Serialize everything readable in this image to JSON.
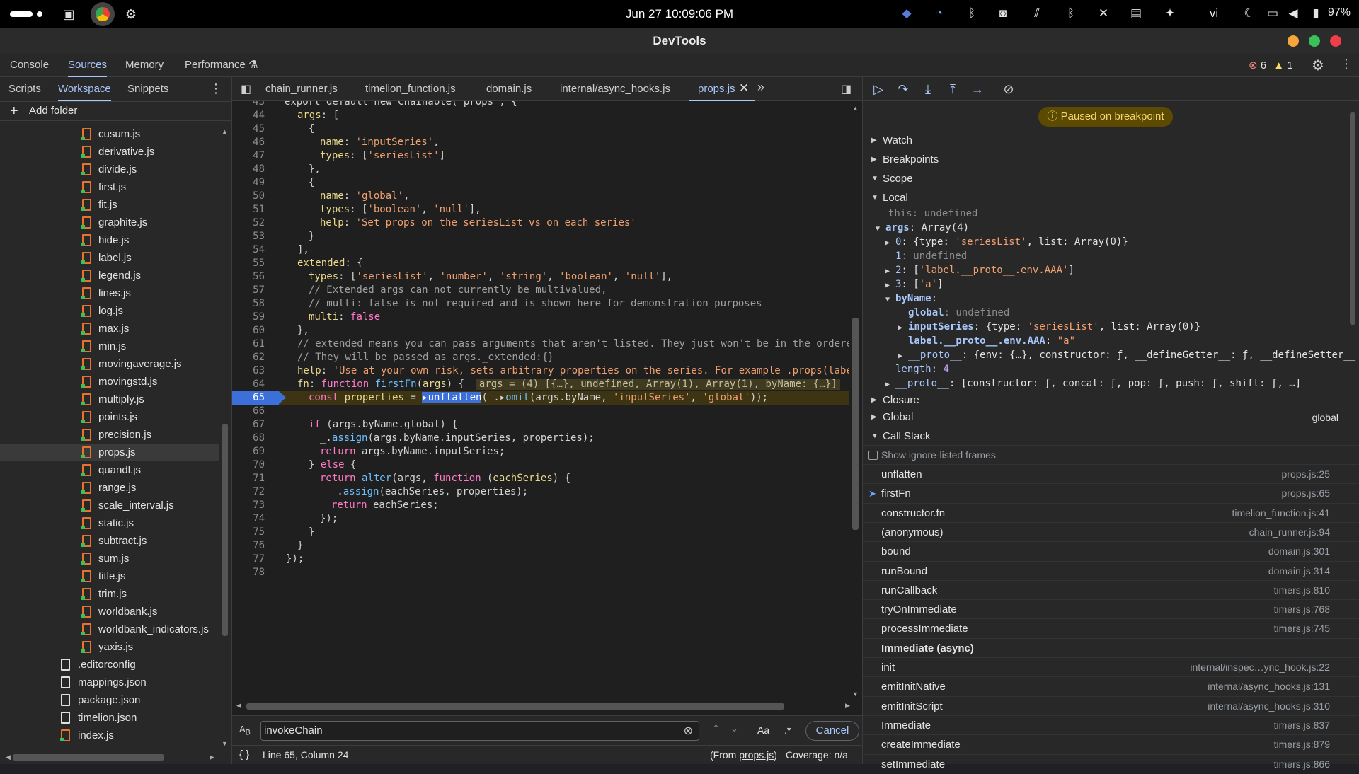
{
  "system": {
    "clock": "Jun 27  10:09:06 PM",
    "battery": "97%",
    "keyboard": "vi"
  },
  "window": {
    "title": "DevTools"
  },
  "main_tabs": [
    "Console",
    "Sources",
    "Memory",
    "Performance"
  ],
  "counts": {
    "errors": "6",
    "warnings": "1"
  },
  "left": {
    "tabs": [
      "Scripts",
      "Workspace",
      "Snippets"
    ],
    "add_folder": "Add folder",
    "files": [
      "cusum.js",
      "derivative.js",
      "divide.js",
      "first.js",
      "fit.js",
      "graphite.js",
      "hide.js",
      "label.js",
      "legend.js",
      "lines.js",
      "log.js",
      "max.js",
      "min.js",
      "movingaverage.js",
      "movingstd.js",
      "multiply.js",
      "points.js",
      "precision.js",
      "props.js",
      "quandl.js",
      "range.js",
      "scale_interval.js",
      "static.js",
      "subtract.js",
      "sum.js",
      "title.js",
      "trim.js",
      "worldbank.js",
      "worldbank_indicators.js",
      "yaxis.js"
    ],
    "other_files": [
      ".editorconfig",
      "mappings.json",
      "package.json",
      "timelion.json",
      "index.js"
    ],
    "selected": "props.js"
  },
  "editor": {
    "tabs": [
      "chain_runner.js",
      "timelion_function.js",
      "domain.js",
      "internal/async_hooks.js",
      "props.js"
    ],
    "first_line_partial": "export default new Chainable('props', {",
    "current_line": "65",
    "search_value": "invokeChain",
    "cancel": "Cancel",
    "case_label": "Aa",
    "regex_label": ".*",
    "status": {
      "position": "Line 65, Column 24",
      "from_prefix": "(From ",
      "from_file": "props.js",
      "from_suffix": ")",
      "coverage": "Coverage: n/a"
    }
  },
  "debugger": {
    "paused": "Paused on breakpoint",
    "sections": {
      "watch": "Watch",
      "breakpoints": "Breakpoints",
      "scope": "Scope",
      "local": "Local",
      "closure": "Closure",
      "global": "Global",
      "global_val": "global",
      "callstack": "Call Stack",
      "ignore": "Show ignore-listed frames"
    },
    "callstack": [
      {
        "name": "unflatten",
        "loc": "props.js:25"
      },
      {
        "name": "firstFn",
        "loc": "props.js:65",
        "current": true
      },
      {
        "name": "constructor.fn",
        "loc": "timelion_function.js:41"
      },
      {
        "name": "(anonymous)",
        "loc": "chain_runner.js:94"
      },
      {
        "name": "bound",
        "loc": "domain.js:301"
      },
      {
        "name": "runBound",
        "loc": "domain.js:314"
      },
      {
        "name": "runCallback",
        "loc": "timers.js:810"
      },
      {
        "name": "tryOnImmediate",
        "loc": "timers.js:768"
      },
      {
        "name": "processImmediate",
        "loc": "timers.js:745"
      },
      {
        "name": "Immediate (async)",
        "loc": "",
        "header": true
      },
      {
        "name": "init",
        "loc": "internal/inspec…ync_hook.js:22"
      },
      {
        "name": "emitInitNative",
        "loc": "internal/async_hooks.js:131"
      },
      {
        "name": "emitInitScript",
        "loc": "internal/async_hooks.js:310"
      },
      {
        "name": "Immediate",
        "loc": "timers.js:837"
      },
      {
        "name": "createImmediate",
        "loc": "timers.js:879"
      },
      {
        "name": "setImmediate",
        "loc": "timers.js:866"
      }
    ]
  }
}
